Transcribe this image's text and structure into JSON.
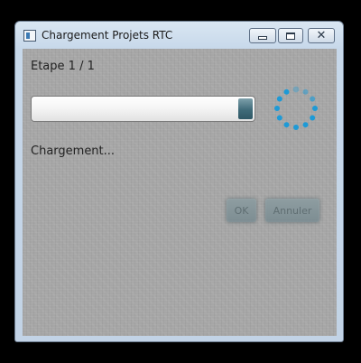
{
  "window": {
    "title": "Chargement Projets RTC",
    "close_glyph": "✕"
  },
  "main": {
    "step_label": "Etape 1 / 1",
    "progress_fraction": 1.0,
    "status_label": "Chargement...",
    "buttons": {
      "ok_label": "OK",
      "cancel_label": "Annuler"
    }
  },
  "colors": {
    "spinner_accent": "#1e9ad6",
    "progress_fill": "#3f6b79"
  },
  "icons": {
    "app": "application-window-icon",
    "minimize": "minimize-icon",
    "maximize": "maximize-icon",
    "close": "close-icon",
    "spinner": "loading-spinner-icon"
  }
}
